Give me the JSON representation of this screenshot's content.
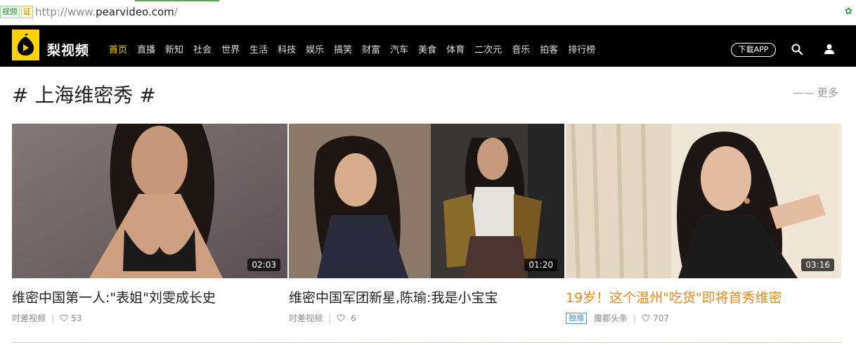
{
  "browser": {
    "badge1": "视频",
    "badge2": "证",
    "url_prefix": "http://www.",
    "url_domain": "pearvideo.com",
    "url_suffix": "/"
  },
  "nav": {
    "logo_text": "梨视频",
    "items": [
      "首页",
      "直播",
      "新知",
      "社会",
      "世界",
      "生活",
      "科技",
      "娱乐",
      "搞笑",
      "财富",
      "汽车",
      "美食",
      "体育",
      "二次元",
      "音乐",
      "拍客",
      "排行榜"
    ],
    "download_label": "下载APP",
    "accent": "#ffd200"
  },
  "section": {
    "title": "# 上海维密秀 #",
    "more": "—— 更多"
  },
  "cards": [
    {
      "duration": "02:03",
      "title": "维密中国第一人:\"表姐\"刘雯成长史",
      "source": "时差视频",
      "likes": "53",
      "highlight": false,
      "tag": ""
    },
    {
      "duration": "01:20",
      "title": "维密中国军团新星,陈瑜:我是小宝宝",
      "source": "时差视频",
      "likes": "6",
      "highlight": false,
      "tag": ""
    },
    {
      "duration": "03:16",
      "title": "19岁！这个温州\"吃货\"即将首秀维密",
      "source": "魔都头条",
      "likes": "707",
      "highlight": true,
      "tag": "独播"
    }
  ]
}
